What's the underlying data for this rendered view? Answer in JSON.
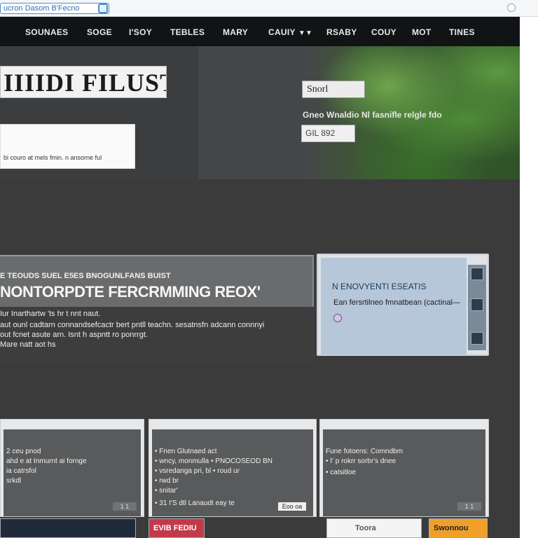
{
  "address_bar": {
    "url": "ucron Dasom B'Fecno"
  },
  "nav": {
    "items": [
      "SOUNAES",
      "SOGE",
      "I'SOY",
      "TEBLES",
      "MARY",
      "CAUIY",
      "RSABY",
      "COUY",
      "MOT",
      "TINES"
    ],
    "dropdown_index": 5
  },
  "hero": {
    "logo_text": "IIIIDI FILUST",
    "box_text": "bi couro at mels fmin. n ansorne ful",
    "tag": "Snorl",
    "caption": "Gneo Wnaldio Nl fasnifle relgle fdo",
    "sub_tag": "GIL 892"
  },
  "feature": {
    "kicker": "E TEOUDS SUEL E5ES BNOGUNLFANS BUIST",
    "title": "NONTORPDTE FERCRMMING REOX'",
    "lines": [
      "Iur Inarthartw 'ts hr t nnt naut.",
      "aut ounl cadtarn connandsefcactr bert pntll teachn. sesatnsfn adcann connnyi",
      "out fcnet asute arn. Isnt h aspntt ro ponrrgt.",
      "Mare natt aot hs"
    ]
  },
  "side_panel": {
    "title": "N ENOVYENTI ESEATIS",
    "text": "Ean fersrtilneo fmnatbean (cactinal—"
  },
  "cards": [
    {
      "lines": [
        "2 ceu pnod",
        "ahd e at Inmurnt ai fornge",
        "ia catrsfol",
        "srkdl"
      ],
      "tag": "1 1"
    },
    {
      "lines": [
        "• Fnen Glutnaed act",
        "• wncy, monmulla • PNOCOSEOD BN",
        "• vsredanga pri, bl • roud ur",
        "• rwd br",
        "• snitar'",
        "• 31 I'S dtl Lanaudt eay te"
      ],
      "tag": "Eoo oa"
    },
    {
      "lines": [
        "Fune fotoens: Comndbm",
        "• I' p rokrr sorbr's dnee",
        "• catsitloe"
      ],
      "tag": "1 1"
    }
  ],
  "bottom_strip": {
    "labels": [
      "",
      "EVIB FEDIU",
      "Toora",
      "Swonnou"
    ]
  },
  "colors": {
    "nav_bg": "#121314",
    "hero_bg": "#3c3d3f",
    "main_bg": "#3b3b3c",
    "accent_blue": "#4a8fd1",
    "strip_red": "#c23a4a",
    "strip_orange": "#f0a02a"
  }
}
